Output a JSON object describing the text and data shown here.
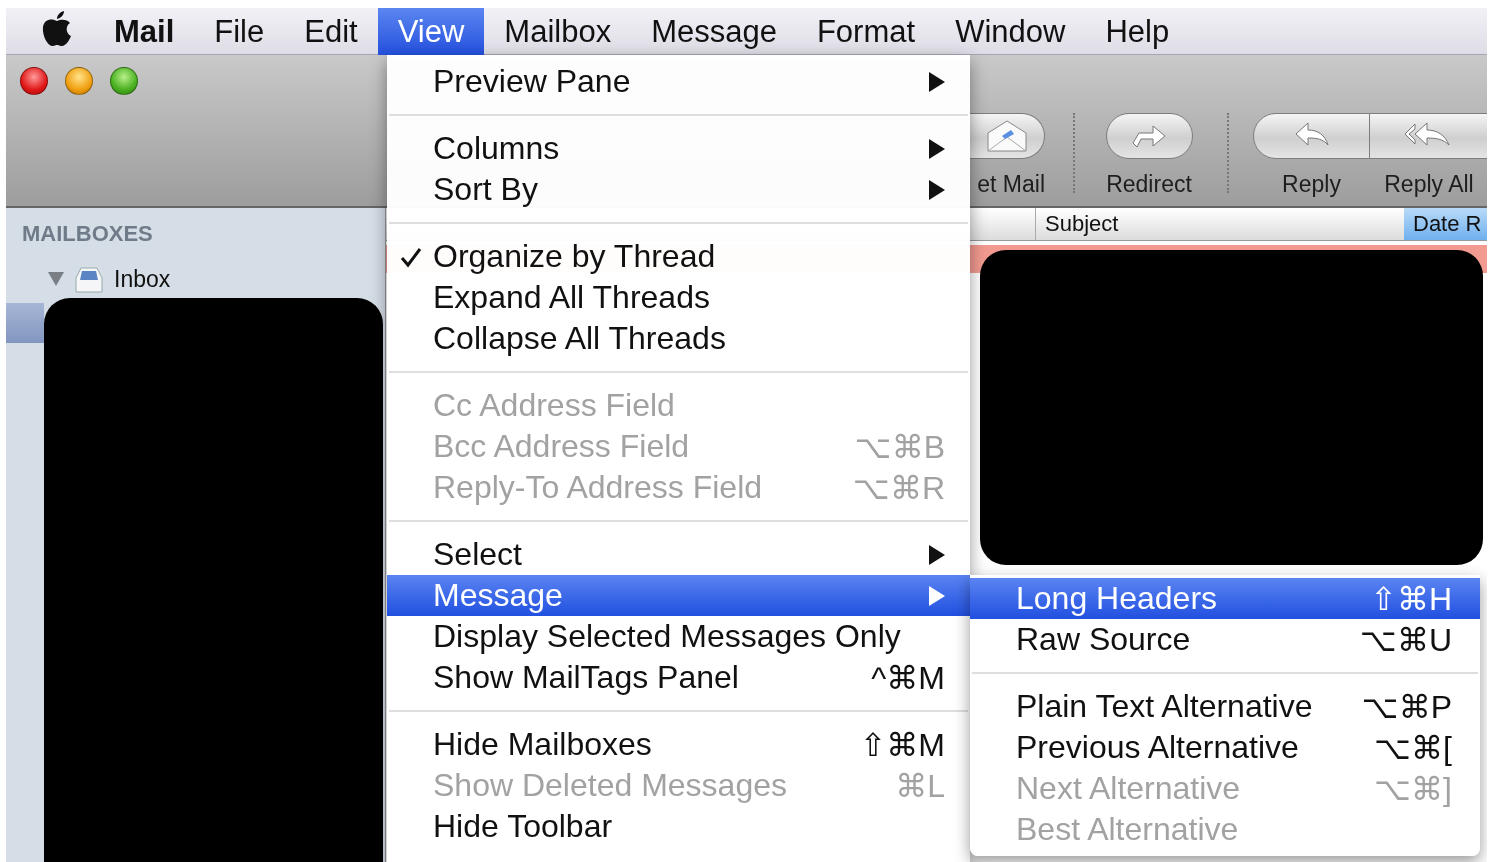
{
  "menubar": {
    "items": [
      {
        "label": "Mail",
        "kind": "app",
        "selected": false
      },
      {
        "label": "File",
        "kind": "menu",
        "selected": false
      },
      {
        "label": "Edit",
        "kind": "menu",
        "selected": false
      },
      {
        "label": "View",
        "kind": "menu",
        "selected": true
      },
      {
        "label": "Mailbox",
        "kind": "menu",
        "selected": false
      },
      {
        "label": "Message",
        "kind": "menu",
        "selected": false
      },
      {
        "label": "Format",
        "kind": "menu",
        "selected": false
      },
      {
        "label": "Window",
        "kind": "menu",
        "selected": false
      },
      {
        "label": "Help",
        "kind": "menu",
        "selected": false
      }
    ]
  },
  "window": {
    "toolbar": [
      {
        "label": "et Mail",
        "kind": "get-mail"
      },
      {
        "label": "Redirect",
        "kind": "redirect"
      },
      {
        "label": "Reply",
        "kind": "reply"
      },
      {
        "label": "Reply All",
        "kind": "reply-all"
      }
    ],
    "sidebar": {
      "heading": "MAILBOXES",
      "items": [
        {
          "label": "Inbox",
          "expanded": true
        }
      ]
    },
    "message_list": {
      "columns": [
        {
          "label": "Subject",
          "selected": false
        },
        {
          "label": "Date R",
          "selected": true
        }
      ]
    }
  },
  "view_menu": {
    "items": [
      {
        "kind": "item",
        "label": "Preview Pane",
        "submenu": true,
        "checked": false,
        "disabled": false,
        "selected": false
      },
      {
        "kind": "separator"
      },
      {
        "kind": "item",
        "label": "Columns",
        "submenu": true,
        "checked": false,
        "disabled": false,
        "selected": false
      },
      {
        "kind": "item",
        "label": "Sort By",
        "submenu": true,
        "checked": false,
        "disabled": false,
        "selected": false
      },
      {
        "kind": "separator"
      },
      {
        "kind": "item",
        "label": "Organize by Thread",
        "submenu": false,
        "checked": true,
        "disabled": false,
        "selected": false
      },
      {
        "kind": "item",
        "label": "Expand All Threads",
        "submenu": false,
        "checked": false,
        "disabled": false,
        "selected": false
      },
      {
        "kind": "item",
        "label": "Collapse All Threads",
        "submenu": false,
        "checked": false,
        "disabled": false,
        "selected": false
      },
      {
        "kind": "separator"
      },
      {
        "kind": "item",
        "label": "Cc Address Field",
        "submenu": false,
        "checked": false,
        "disabled": true,
        "selected": false
      },
      {
        "kind": "item",
        "label": "Bcc Address Field",
        "shortcut": "⌥⌘B",
        "submenu": false,
        "checked": false,
        "disabled": true,
        "selected": false
      },
      {
        "kind": "item",
        "label": "Reply-To Address Field",
        "shortcut": "⌥⌘R",
        "submenu": false,
        "checked": false,
        "disabled": true,
        "selected": false
      },
      {
        "kind": "separator"
      },
      {
        "kind": "item",
        "label": "Select",
        "submenu": true,
        "checked": false,
        "disabled": false,
        "selected": false
      },
      {
        "kind": "item",
        "label": "Message",
        "submenu": true,
        "checked": false,
        "disabled": false,
        "selected": true
      },
      {
        "kind": "item",
        "label": "Display Selected Messages Only",
        "submenu": false,
        "checked": false,
        "disabled": false,
        "selected": false
      },
      {
        "kind": "item",
        "label": "Show MailTags Panel",
        "shortcut": "^⌘M",
        "submenu": false,
        "checked": false,
        "disabled": false,
        "selected": false
      },
      {
        "kind": "separator"
      },
      {
        "kind": "item",
        "label": "Hide Mailboxes",
        "shortcut": "⇧⌘M",
        "submenu": false,
        "checked": false,
        "disabled": false,
        "selected": false
      },
      {
        "kind": "item",
        "label": "Show Deleted Messages",
        "shortcut": "⌘L",
        "submenu": false,
        "checked": false,
        "disabled": true,
        "selected": false
      },
      {
        "kind": "item",
        "label": "Hide Toolbar",
        "submenu": false,
        "checked": false,
        "disabled": false,
        "selected": false
      }
    ]
  },
  "message_submenu": {
    "items": [
      {
        "kind": "item",
        "label": "Long Headers",
        "shortcut": "⇧⌘H",
        "submenu": false,
        "checked": false,
        "disabled": false,
        "selected": true
      },
      {
        "kind": "item",
        "label": "Raw Source",
        "shortcut": "⌥⌘U",
        "submenu": false,
        "checked": false,
        "disabled": false,
        "selected": false
      },
      {
        "kind": "separator"
      },
      {
        "kind": "item",
        "label": "Plain Text Alternative",
        "shortcut": "⌥⌘P",
        "submenu": false,
        "checked": false,
        "disabled": false,
        "selected": false
      },
      {
        "kind": "item",
        "label": "Previous Alternative",
        "shortcut": "⌥⌘[",
        "submenu": false,
        "checked": false,
        "disabled": false,
        "selected": false
      },
      {
        "kind": "item",
        "label": "Next Alternative",
        "shortcut": "⌥⌘]",
        "submenu": false,
        "checked": false,
        "disabled": true,
        "selected": false
      },
      {
        "kind": "item",
        "label": "Best Alternative",
        "submenu": false,
        "checked": false,
        "disabled": true,
        "selected": false
      }
    ]
  }
}
